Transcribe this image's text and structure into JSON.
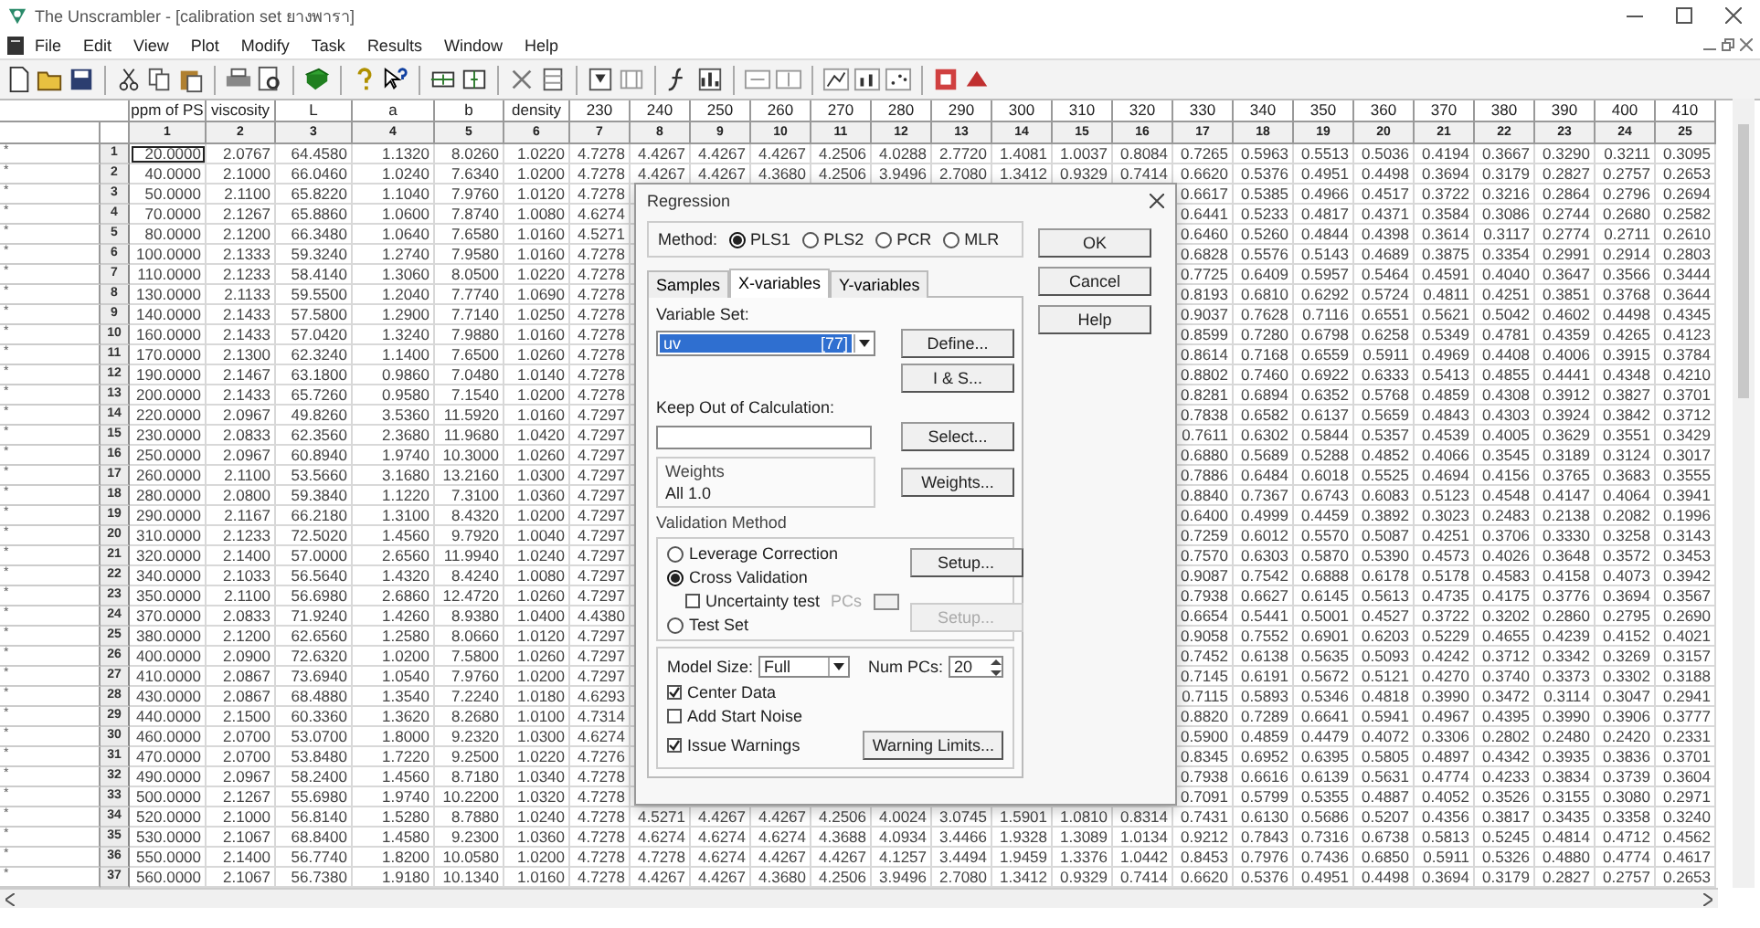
{
  "window": {
    "title": "The Unscrambler - [calibration set ยางพารา]"
  },
  "menu": [
    "File",
    "Edit",
    "View",
    "Plot",
    "Modify",
    "Task",
    "Results",
    "Window",
    "Help"
  ],
  "table": {
    "columns": [
      {
        "name": "ppm of PS",
        "index": "1"
      },
      {
        "name": "viscosity",
        "index": "2"
      },
      {
        "name": "L",
        "index": "3"
      },
      {
        "name": "a",
        "index": "4"
      },
      {
        "name": "b",
        "index": "5"
      },
      {
        "name": "density",
        "index": "6"
      },
      {
        "name": "230",
        "index": "7"
      },
      {
        "name": "240",
        "index": "8"
      },
      {
        "name": "250",
        "index": "9"
      },
      {
        "name": "260",
        "index": "10"
      },
      {
        "name": "270",
        "index": "11"
      },
      {
        "name": "280",
        "index": "12"
      },
      {
        "name": "290",
        "index": "13"
      },
      {
        "name": "300",
        "index": "14"
      },
      {
        "name": "310",
        "index": "15"
      },
      {
        "name": "320",
        "index": "16"
      },
      {
        "name": "330",
        "index": "17"
      },
      {
        "name": "340",
        "index": "18"
      },
      {
        "name": "350",
        "index": "19"
      },
      {
        "name": "360",
        "index": "20"
      },
      {
        "name": "370",
        "index": "21"
      },
      {
        "name": "380",
        "index": "22"
      },
      {
        "name": "390",
        "index": "23"
      },
      {
        "name": "400",
        "index": "24"
      },
      {
        "name": "410",
        "index": "25"
      }
    ],
    "rows": [
      {
        "name": "*",
        "number": "1",
        "cells": [
          "20.0000",
          "2.0767",
          "64.4580",
          "1.1320",
          "8.0260",
          "1.0220",
          "4.7278",
          "4.4267",
          "4.4267",
          "4.4267",
          "4.2506",
          "4.0288",
          "2.7720",
          "1.4081",
          "1.0037",
          "0.8084",
          "0.7265",
          "0.5963",
          "0.5513",
          "0.5036",
          "0.4194",
          "0.3667",
          "0.3290",
          "0.3211",
          "0.3095"
        ]
      },
      {
        "name": "*",
        "number": "2",
        "cells": [
          "40.0000",
          "2.1000",
          "66.0460",
          "1.0240",
          "7.6340",
          "1.0200",
          "4.7278",
          "4.4267",
          "4.4267",
          "4.3680",
          "4.2506",
          "3.9496",
          "2.7080",
          "1.3412",
          "0.9329",
          "0.7414",
          "0.6620",
          "0.5376",
          "0.4951",
          "0.4498",
          "0.3694",
          "0.3179",
          "0.2827",
          "0.2757",
          "0.2653"
        ]
      },
      {
        "name": "*",
        "number": "3",
        "cells": [
          "50.0000",
          "2.1100",
          "65.8220",
          "1.1040",
          "7.9760",
          "1.0120",
          "4.7278",
          null,
          null,
          null,
          null,
          null,
          null,
          null,
          null,
          null,
          "0.6617",
          "0.5385",
          "0.4966",
          "0.4517",
          "0.3722",
          "0.3216",
          "0.2864",
          "0.2796",
          "0.2694"
        ]
      },
      {
        "name": "*",
        "number": "4",
        "cells": [
          "70.0000",
          "2.1267",
          "65.8860",
          "1.0600",
          "7.8740",
          "1.0080",
          "4.6274",
          null,
          null,
          null,
          null,
          null,
          null,
          null,
          null,
          null,
          "0.6441",
          "0.5233",
          "0.4817",
          "0.4371",
          "0.3584",
          "0.3086",
          "0.2744",
          "0.2680",
          "0.2582"
        ]
      },
      {
        "name": "*",
        "number": "5",
        "cells": [
          "80.0000",
          "2.1200",
          "66.3480",
          "1.0640",
          "7.6580",
          "1.0160",
          "4.5271",
          null,
          null,
          null,
          null,
          null,
          null,
          null,
          null,
          null,
          "0.6460",
          "0.5260",
          "0.4844",
          "0.4398",
          "0.3614",
          "0.3117",
          "0.2774",
          "0.2711",
          "0.2610"
        ]
      },
      {
        "name": "*",
        "number": "6",
        "cells": [
          "100.0000",
          "2.1333",
          "59.3240",
          "1.2740",
          "7.9580",
          "1.0160",
          "4.7278",
          null,
          null,
          null,
          null,
          null,
          null,
          null,
          null,
          null,
          "0.6828",
          "0.5576",
          "0.5143",
          "0.4689",
          "0.3875",
          "0.3354",
          "0.2991",
          "0.2914",
          "0.2803"
        ]
      },
      {
        "name": "*",
        "number": "7",
        "cells": [
          "110.0000",
          "2.1233",
          "58.4140",
          "1.3060",
          "8.0500",
          "1.0220",
          "4.7278",
          null,
          null,
          null,
          null,
          null,
          null,
          null,
          null,
          null,
          "0.7725",
          "0.6409",
          "0.5957",
          "0.5464",
          "0.4591",
          "0.4040",
          "0.3647",
          "0.3566",
          "0.3444"
        ]
      },
      {
        "name": "*",
        "number": "8",
        "cells": [
          "130.0000",
          "2.1133",
          "59.5500",
          "1.2040",
          "7.7740",
          "1.0690",
          "4.7278",
          null,
          null,
          null,
          null,
          null,
          null,
          null,
          null,
          null,
          "0.8193",
          "0.6810",
          "0.6292",
          "0.5724",
          "0.4811",
          "0.4251",
          "0.3851",
          "0.3768",
          "0.3644"
        ]
      },
      {
        "name": "*",
        "number": "9",
        "cells": [
          "140.0000",
          "2.1433",
          "57.5800",
          "1.2900",
          "7.7140",
          "1.0250",
          "4.7278",
          null,
          null,
          null,
          null,
          null,
          null,
          null,
          null,
          null,
          "0.9037",
          "0.7628",
          "0.7116",
          "0.6551",
          "0.5621",
          "0.5042",
          "0.4602",
          "0.4498",
          "0.4345"
        ]
      },
      {
        "name": "*",
        "number": "10",
        "cells": [
          "160.0000",
          "2.1433",
          "57.0420",
          "1.3240",
          "7.9880",
          "1.0160",
          "4.7278",
          null,
          null,
          null,
          null,
          null,
          null,
          null,
          null,
          null,
          "0.8599",
          "0.7280",
          "0.6798",
          "0.6258",
          "0.5349",
          "0.4781",
          "0.4359",
          "0.4265",
          "0.4123"
        ]
      },
      {
        "name": "*",
        "number": "11",
        "cells": [
          "170.0000",
          "2.1300",
          "62.3240",
          "1.1400",
          "7.6500",
          "1.0260",
          "4.7278",
          null,
          null,
          null,
          null,
          null,
          null,
          null,
          null,
          null,
          "0.8614",
          "0.7168",
          "0.6559",
          "0.5911",
          "0.4969",
          "0.4408",
          "0.4006",
          "0.3915",
          "0.3784"
        ]
      },
      {
        "name": "*",
        "number": "12",
        "cells": [
          "190.0000",
          "2.1467",
          "63.1800",
          "0.9860",
          "7.0480",
          "1.0140",
          "4.7278",
          null,
          null,
          null,
          null,
          null,
          null,
          null,
          null,
          null,
          "0.8802",
          "0.7460",
          "0.6922",
          "0.6333",
          "0.5413",
          "0.4855",
          "0.4441",
          "0.4348",
          "0.4210"
        ]
      },
      {
        "name": "*",
        "number": "13",
        "cells": [
          "200.0000",
          "2.1433",
          "65.7260",
          "0.9580",
          "7.1540",
          "1.0200",
          "4.7278",
          null,
          null,
          null,
          null,
          null,
          null,
          null,
          null,
          null,
          "0.8281",
          "0.6894",
          "0.6352",
          "0.5768",
          "0.4859",
          "0.4308",
          "0.3912",
          "0.3827",
          "0.3701"
        ]
      },
      {
        "name": "*",
        "number": "14",
        "cells": [
          "220.0000",
          "2.0967",
          "49.8260",
          "3.5360",
          "11.5920",
          "1.0160",
          "4.7297",
          null,
          null,
          null,
          null,
          null,
          null,
          null,
          null,
          null,
          "0.7838",
          "0.6582",
          "0.6137",
          "0.5659",
          "0.4843",
          "0.4303",
          "0.3924",
          "0.3842",
          "0.3712"
        ]
      },
      {
        "name": "*",
        "number": "15",
        "cells": [
          "230.0000",
          "2.0833",
          "62.3560",
          "2.3680",
          "11.9680",
          "1.0420",
          "4.7297",
          null,
          null,
          null,
          null,
          null,
          null,
          null,
          null,
          null,
          "0.7611",
          "0.6302",
          "0.5844",
          "0.5357",
          "0.4539",
          "0.4005",
          "0.3629",
          "0.3551",
          "0.3429"
        ]
      },
      {
        "name": "*",
        "number": "16",
        "cells": [
          "250.0000",
          "2.0967",
          "60.8940",
          "1.9740",
          "10.3000",
          "1.0260",
          "4.7297",
          null,
          null,
          null,
          null,
          null,
          null,
          null,
          null,
          null,
          "0.6880",
          "0.5689",
          "0.5288",
          "0.4852",
          "0.4066",
          "0.3545",
          "0.3189",
          "0.3124",
          "0.3017"
        ]
      },
      {
        "name": "*",
        "number": "17",
        "cells": [
          "260.0000",
          "2.1100",
          "53.5660",
          "3.1680",
          "13.2160",
          "1.0300",
          "4.7297",
          null,
          null,
          null,
          null,
          null,
          null,
          null,
          null,
          null,
          "0.7886",
          "0.6484",
          "0.6018",
          "0.5525",
          "0.4694",
          "0.4156",
          "0.3765",
          "0.3683",
          "0.3555"
        ]
      },
      {
        "name": "*",
        "number": "18",
        "cells": [
          "280.0000",
          "2.0800",
          "59.3840",
          "1.1220",
          "7.3100",
          "1.0360",
          "4.7297",
          null,
          null,
          null,
          null,
          null,
          null,
          null,
          null,
          null,
          "0.8840",
          "0.7367",
          "0.6743",
          "0.6083",
          "0.5123",
          "0.4548",
          "0.4147",
          "0.4064",
          "0.3941"
        ]
      },
      {
        "name": "*",
        "number": "19",
        "cells": [
          "290.0000",
          "2.1167",
          "66.2180",
          "1.3100",
          "8.4320",
          "1.0200",
          "4.7297",
          null,
          null,
          null,
          null,
          null,
          null,
          null,
          null,
          null,
          "0.6400",
          "0.4999",
          "0.4459",
          "0.3892",
          "0.3023",
          "0.2483",
          "0.2138",
          "0.2082",
          "0.1996"
        ]
      },
      {
        "name": "*",
        "number": "20",
        "cells": [
          "310.0000",
          "2.1233",
          "72.5020",
          "1.4560",
          "9.7920",
          "1.0040",
          "4.7297",
          null,
          null,
          null,
          null,
          null,
          null,
          null,
          null,
          null,
          "0.7259",
          "0.6012",
          "0.5570",
          "0.5087",
          "0.4251",
          "0.3706",
          "0.3330",
          "0.3258",
          "0.3143"
        ]
      },
      {
        "name": "*",
        "number": "21",
        "cells": [
          "320.0000",
          "2.1400",
          "57.0000",
          "2.6560",
          "11.9940",
          "1.0240",
          "4.7297",
          null,
          null,
          null,
          null,
          null,
          null,
          null,
          null,
          null,
          "0.7570",
          "0.6303",
          "0.5870",
          "0.5390",
          "0.4573",
          "0.4026",
          "0.3648",
          "0.3572",
          "0.3453"
        ]
      },
      {
        "name": "*",
        "number": "22",
        "cells": [
          "340.0000",
          "2.1033",
          "56.5640",
          "1.4320",
          "8.4240",
          "1.0080",
          "4.7297",
          null,
          null,
          null,
          null,
          null,
          null,
          null,
          null,
          null,
          "0.9087",
          "0.7542",
          "0.6888",
          "0.6178",
          "0.5178",
          "0.4583",
          "0.4158",
          "0.4073",
          "0.3942"
        ]
      },
      {
        "name": "*",
        "number": "23",
        "cells": [
          "350.0000",
          "2.1100",
          "56.6980",
          "2.6860",
          "12.4720",
          "1.0260",
          "4.7297",
          null,
          null,
          null,
          null,
          null,
          null,
          null,
          null,
          null,
          "0.7938",
          "0.6627",
          "0.6145",
          "0.5613",
          "0.4735",
          "0.4175",
          "0.3776",
          "0.3694",
          "0.3567"
        ]
      },
      {
        "name": "*",
        "number": "24",
        "cells": [
          "370.0000",
          "2.0833",
          "71.9240",
          "1.4260",
          "8.9380",
          "1.0400",
          "4.4380",
          null,
          null,
          null,
          null,
          null,
          null,
          null,
          null,
          null,
          "0.6654",
          "0.5441",
          "0.5001",
          "0.4527",
          "0.3722",
          "0.3202",
          "0.2860",
          "0.2795",
          "0.2690"
        ]
      },
      {
        "name": "*",
        "number": "25",
        "cells": [
          "380.0000",
          "2.1200",
          "62.6560",
          "1.2580",
          "8.0660",
          "1.0120",
          "4.7297",
          null,
          null,
          null,
          null,
          null,
          null,
          null,
          null,
          null,
          "0.9058",
          "0.7552",
          "0.6901",
          "0.6203",
          "0.5229",
          "0.4655",
          "0.4239",
          "0.4152",
          "0.4021"
        ]
      },
      {
        "name": "*",
        "number": "26",
        "cells": [
          "400.0000",
          "2.0900",
          "72.6320",
          "1.0200",
          "7.5800",
          "1.0260",
          "4.7297",
          null,
          null,
          null,
          null,
          null,
          null,
          null,
          null,
          null,
          "0.7452",
          "0.6138",
          "0.5635",
          "0.5093",
          "0.4242",
          "0.3712",
          "0.3342",
          "0.3269",
          "0.3157"
        ]
      },
      {
        "name": "*",
        "number": "27",
        "cells": [
          "410.0000",
          "2.0867",
          "73.6940",
          "1.0540",
          "7.9760",
          "1.0200",
          "4.7297",
          null,
          null,
          null,
          null,
          null,
          null,
          null,
          null,
          null,
          "0.7145",
          "0.6191",
          "0.5672",
          "0.5121",
          "0.4270",
          "0.3740",
          "0.3373",
          "0.3302",
          "0.3188"
        ]
      },
      {
        "name": "*",
        "number": "28",
        "cells": [
          "430.0000",
          "2.0867",
          "68.4880",
          "1.3540",
          "7.2240",
          "1.0180",
          "4.6293",
          null,
          null,
          null,
          null,
          null,
          null,
          null,
          null,
          null,
          "0.7115",
          "0.5893",
          "0.5346",
          "0.4818",
          "0.3990",
          "0.3472",
          "0.3114",
          "0.3047",
          "0.2941"
        ]
      },
      {
        "name": "*",
        "number": "29",
        "cells": [
          "440.0000",
          "2.1500",
          "60.3360",
          "1.3620",
          "8.2680",
          "1.0100",
          "4.7314",
          null,
          null,
          null,
          null,
          null,
          null,
          null,
          null,
          null,
          "0.8820",
          "0.7289",
          "0.6641",
          "0.5941",
          "0.4967",
          "0.4395",
          "0.3990",
          "0.3906",
          "0.3777"
        ]
      },
      {
        "name": "*",
        "number": "30",
        "cells": [
          "460.0000",
          "2.0700",
          "53.0700",
          "1.8000",
          "9.2320",
          "1.0300",
          "4.6274",
          null,
          null,
          null,
          null,
          null,
          null,
          null,
          null,
          null,
          "0.5900",
          "0.4859",
          "0.4479",
          "0.4072",
          "0.3306",
          "0.2802",
          "0.2480",
          "0.2420",
          "0.2331"
        ]
      },
      {
        "name": "*",
        "number": "31",
        "cells": [
          "470.0000",
          "2.0700",
          "53.8480",
          "1.7220",
          "9.2500",
          "1.0220",
          "4.7276",
          null,
          null,
          null,
          null,
          null,
          null,
          null,
          null,
          null,
          "0.8345",
          "0.6952",
          "0.6395",
          "0.5805",
          "0.4897",
          "0.4342",
          "0.3935",
          "0.3836",
          "0.3701"
        ]
      },
      {
        "name": "*",
        "number": "32",
        "cells": [
          "490.0000",
          "2.0967",
          "58.2400",
          "1.4560",
          "8.7180",
          "1.0340",
          "4.7278",
          null,
          null,
          null,
          null,
          null,
          null,
          null,
          null,
          null,
          "0.7938",
          "0.6616",
          "0.6139",
          "0.5631",
          "0.4774",
          "0.4233",
          "0.3834",
          "0.3739",
          "0.3604"
        ]
      },
      {
        "name": "*",
        "number": "33",
        "cells": [
          "500.0000",
          "2.1267",
          "55.6980",
          "1.9740",
          "10.2200",
          "1.0320",
          "4.7278",
          null,
          null,
          null,
          null,
          null,
          null,
          null,
          null,
          null,
          "0.7091",
          "0.5799",
          "0.5355",
          "0.4887",
          "0.4052",
          "0.3526",
          "0.3155",
          "0.3080",
          "0.2971"
        ]
      },
      {
        "name": "*",
        "number": "34",
        "cells": [
          "520.0000",
          "2.1000",
          "56.8140",
          "1.5280",
          "8.7880",
          "1.0240",
          "4.7278",
          "4.5271",
          "4.4267",
          "4.4267",
          "4.2506",
          "4.0024",
          "3.0745",
          "1.5901",
          "1.0810",
          "0.8314",
          "0.7431",
          "0.6130",
          "0.5686",
          "0.5207",
          "0.4356",
          "0.3817",
          "0.3435",
          "0.3358",
          "0.3240"
        ]
      },
      {
        "name": "*",
        "number": "35",
        "cells": [
          "530.0000",
          "2.1067",
          "68.8400",
          "1.4580",
          "9.2300",
          "1.0360",
          "4.7278",
          "4.6274",
          "4.6274",
          "4.6274",
          "4.3688",
          "4.0934",
          "3.4466",
          "1.9328",
          "1.3089",
          "1.0134",
          "0.9212",
          "0.7843",
          "0.7316",
          "0.6738",
          "0.5813",
          "0.5245",
          "0.4814",
          "0.4712",
          "0.4562"
        ]
      },
      {
        "name": "*",
        "number": "36",
        "cells": [
          "550.0000",
          "2.1400",
          "56.7740",
          "1.8200",
          "10.0580",
          "1.0200",
          "4.7278",
          "4.7278",
          "4.6274",
          "4.4267",
          "4.4267",
          "4.1257",
          "3.4494",
          "1.9459",
          "1.3376",
          "1.0442",
          "0.8453",
          "0.7976",
          "0.7436",
          "0.6850",
          "0.5911",
          "0.5326",
          "0.4880",
          "0.4774",
          "0.4617"
        ]
      },
      {
        "name": "*",
        "number": "37",
        "cells": [
          "560.0000",
          "2.1067",
          "56.7380",
          "1.9180",
          "10.1340",
          "1.0160",
          "4.7278",
          "4.4267",
          "4.4267",
          "4.3680",
          "4.2506",
          "3.9496",
          "2.7080",
          "1.3412",
          "0.9329",
          "0.7414",
          "0.6620",
          "0.5376",
          "0.4951",
          "0.4498",
          "0.3694",
          "0.3179",
          "0.2827",
          "0.2757",
          "0.2653"
        ]
      }
    ]
  },
  "dialog": {
    "title": "Regression",
    "method_label": "Method:",
    "methods": [
      {
        "label": "PLS1",
        "selected": true
      },
      {
        "label": "PLS2",
        "selected": false
      },
      {
        "label": "PCR",
        "selected": false
      },
      {
        "label": "MLR",
        "selected": false
      }
    ],
    "tabs": [
      {
        "label": "Samples",
        "selected": false
      },
      {
        "label": "X-variables",
        "selected": true
      },
      {
        "label": "Y-variables",
        "selected": false
      }
    ],
    "variable_set_label": "Variable Set:",
    "variable_set": {
      "value": "uv",
      "count": "[77]"
    },
    "keep_out_label": "Keep Out of Calculation:",
    "weights_title": "Weights",
    "weights_value": "All 1.0",
    "side_buttons": [
      "Define...",
      "I & S...",
      "Select...",
      "Weights..."
    ],
    "validation_title": "Validation Method",
    "validation_options": [
      {
        "label": "Leverage Correction",
        "selected": false
      },
      {
        "label": "Cross Validation",
        "selected": true
      },
      {
        "label": "Test Set",
        "selected": false
      }
    ],
    "uncertainty": {
      "label": "Uncertainty test",
      "checked": false
    },
    "pcs_label": "PCs",
    "setup_buttons": [
      {
        "label": "Setup...",
        "disabled": false
      },
      {
        "label": "Setup...",
        "disabled": true
      }
    ],
    "model_size_label": "Model Size:",
    "model_size": "Full",
    "num_pcs_label": "Num PCs:",
    "num_pcs": "20",
    "options": [
      {
        "label": "Center Data",
        "checked": true
      },
      {
        "label": "Add Start Noise",
        "checked": false
      },
      {
        "label": "Issue Warnings",
        "checked": true
      }
    ],
    "warning_button": "Warning Limits...",
    "buttons": [
      "OK",
      "Cancel",
      "Help"
    ]
  }
}
